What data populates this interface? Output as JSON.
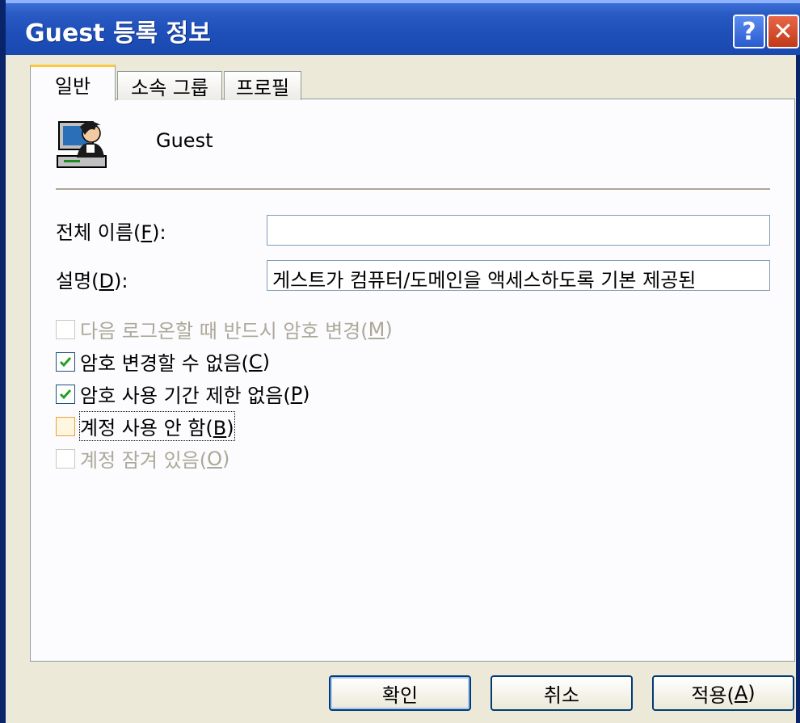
{
  "window": {
    "title": "Guest 등록 정보",
    "help_label": "?",
    "close_label": "✕"
  },
  "tabs": [
    {
      "label": "일반",
      "active": true
    },
    {
      "label": "소속 그룹",
      "active": false
    },
    {
      "label": "프로필",
      "active": false
    }
  ],
  "user": {
    "icon": "user-computer-icon",
    "name": "Guest"
  },
  "form": {
    "fullname": {
      "label_prefix": "전체 이름(",
      "accel": "F",
      "label_suffix": "):",
      "value": ""
    },
    "description": {
      "label_prefix": "설명(",
      "accel": "D",
      "label_suffix": "):",
      "value": "게스트가 컴퓨터/도메인을 액세스하도록 기본 제공된"
    }
  },
  "checkboxes": [
    {
      "prefix": "다음 로그온할 때 반드시 암호 변경(",
      "accel": "M",
      "suffix": ")",
      "checked": false,
      "disabled": true
    },
    {
      "prefix": "암호 변경할 수 없음(",
      "accel": "C",
      "suffix": ")",
      "checked": true,
      "disabled": false
    },
    {
      "prefix": "암호 사용 기간 제한 없음(",
      "accel": "P",
      "suffix": ")",
      "checked": true,
      "disabled": false
    },
    {
      "prefix": "계정 사용 안 함(",
      "accel": "B",
      "suffix": ")",
      "checked": false,
      "disabled": false,
      "focused": true
    },
    {
      "prefix": "계정 잠겨 있음(",
      "accel": "O",
      "suffix": ")",
      "checked": false,
      "disabled": true
    }
  ],
  "buttons": {
    "ok": "확인",
    "cancel": "취소",
    "apply_prefix": "적용(",
    "apply_accel": "A",
    "apply_suffix": ")"
  },
  "colors": {
    "titlebar": "#1f4fb8",
    "face": "#ece9d8",
    "check": "#21a121",
    "tab_highlight": "#ffc83c"
  }
}
